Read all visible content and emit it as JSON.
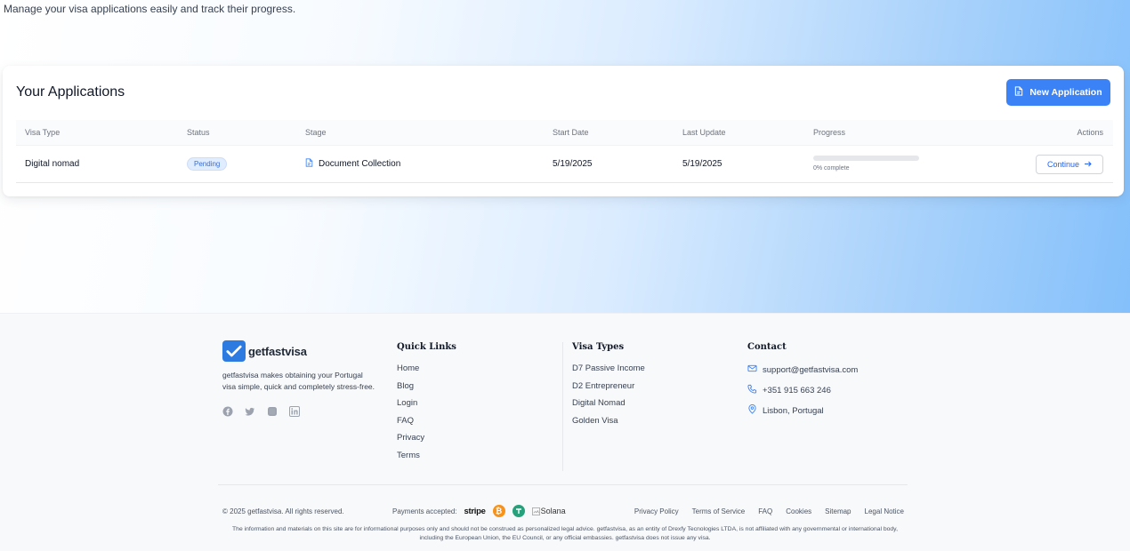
{
  "header": {
    "subtitle": "Manage your visa applications easily and track their progress."
  },
  "applications": {
    "title": "Your Applications",
    "new_button": "New Application",
    "columns": [
      "Visa Type",
      "Status",
      "Stage",
      "Start Date",
      "Last Update",
      "Progress",
      "Actions"
    ],
    "rows": [
      {
        "visa_type": "Digital nomad",
        "status": "Pending",
        "stage": "Document Collection",
        "start_date": "5/19/2025",
        "last_update": "5/19/2025",
        "progress_percent": 0,
        "progress_text": "0% complete",
        "action": "Continue"
      }
    ]
  },
  "footer": {
    "brand_name": "getfastvisa",
    "description": "getfastvisa makes obtaining your Portugal visa simple, quick and completely stress-free.",
    "socials": [
      "facebook-icon",
      "twitter-icon",
      "instagram-icon",
      "linkedin-icon"
    ],
    "quick_links": {
      "title": "Quick Links",
      "items": [
        "Home",
        "Blog",
        "Login",
        "FAQ",
        "Privacy",
        "Terms"
      ]
    },
    "visa_types": {
      "title": "Visa Types",
      "items": [
        "D7 Passive Income",
        "D2 Entrepreneur",
        "Digital Nomad",
        "Golden Visa"
      ]
    },
    "contact": {
      "title": "Contact",
      "email": "support@getfastvisa.com",
      "phone": "+351 915 663 246",
      "location": "Lisbon, Portugal"
    },
    "copyright": "© 2025 getfastvisa. All rights reserved.",
    "payments_label": "Payments accepted:",
    "payment_stripe": "stripe",
    "payment_solana": "Solana",
    "legal_links": [
      "Privacy Policy",
      "Terms of Service",
      "FAQ",
      "Cookies",
      "Sitemap",
      "Legal Notice"
    ],
    "disclaimer": "The information and materials on this site are for informational purposes only and should not be construed as personalized legal advice. getfastvisa, as an entity of Drexfy Tecnologies LTDA, is not affiliated with any governmental or international body, including the European Union, the EU Council, or any official embassies. getfastvisa does not issue any visa."
  },
  "colors": {
    "accent": "#3b82f6",
    "badge_bg": "#e0ecff",
    "bitcoin": "#f7931a",
    "tether": "#26a17b"
  }
}
